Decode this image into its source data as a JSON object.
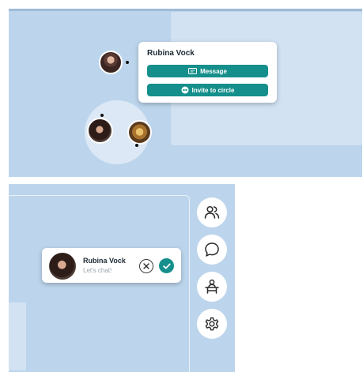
{
  "map": {
    "popup": {
      "name": "Rubina Vock",
      "message_label": "Message",
      "invite_label": "Invite to circle"
    }
  },
  "notification": {
    "name": "Rubina Vock",
    "message": "Let's chat!"
  },
  "sidebar": {
    "items": [
      {
        "icon": "people-icon"
      },
      {
        "icon": "chat-bubble-icon"
      },
      {
        "icon": "desk-icon"
      },
      {
        "icon": "gear-icon"
      }
    ]
  },
  "colors": {
    "accent": "#158f8b",
    "background": "#bcd5ec",
    "room": "#d2e2f2"
  }
}
